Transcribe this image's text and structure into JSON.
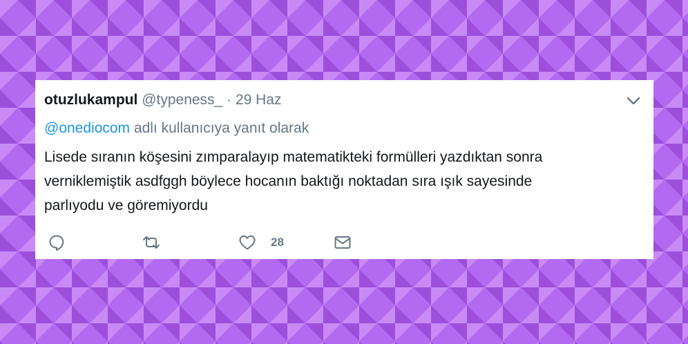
{
  "colors": {
    "background": "#b36af0",
    "pattern_dark": "#9d4fdc",
    "pattern_light": "#c98af6",
    "name": "#14171a",
    "secondary": "#657786",
    "mention": "#1b95e0"
  },
  "tweet": {
    "display_name": "otuzlukampul",
    "handle": "@typeness_",
    "separator": "·",
    "date": "29 Haz",
    "reply_mention": "@onediocom",
    "reply_text": "adlı kullanıcıya yanıt olarak",
    "body_lines": [
      "Lisede sıranın köşesini zımparalayıp matematikteki formülleri yazdıktan sonra",
      "verniklemiştik asdfggh böylece hocanın baktığı noktadan sıra ışık sayesinde",
      "parlıyodu ve göremiyordu"
    ],
    "like_count": "28",
    "icons": {
      "menu": "chevron-down-icon",
      "reply": "reply-icon",
      "retweet": "retweet-icon",
      "like": "heart-icon",
      "dm": "envelope-icon"
    }
  }
}
